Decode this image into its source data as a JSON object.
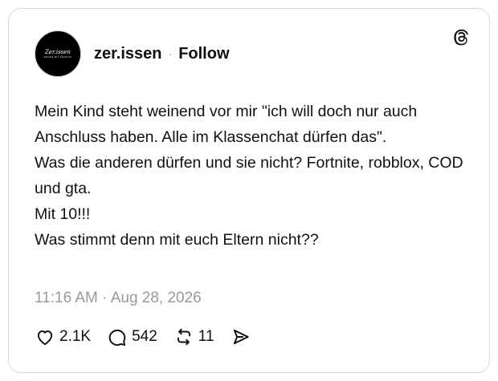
{
  "post": {
    "avatar_text": "Zer.issen",
    "avatar_subtext": "ESSEN MIT GENUSS",
    "username": "zer.issen",
    "separator": "·",
    "follow_label": "Follow",
    "text": "Mein Kind steht weinend vor mir \"ich will doch nur auch Anschluss haben. Alle im Klassenchat dürfen das\".\nWas die anderen dürfen und sie nicht? Fortnite, robblox, COD und gta.\nMit 10!!!\nWas stimmt denn mit euch Eltern nicht??",
    "timestamp": "11:16 AM · Aug 28, 2026"
  },
  "actions": {
    "likes": "2.1K",
    "replies": "542",
    "reposts": "11"
  },
  "icons": [
    "threads-logo-icon",
    "heart-icon",
    "comment-icon",
    "repost-icon",
    "share-icon"
  ],
  "colors": {
    "text": "#101010",
    "muted": "#9a9a9a",
    "border": "#d9d9d9"
  }
}
